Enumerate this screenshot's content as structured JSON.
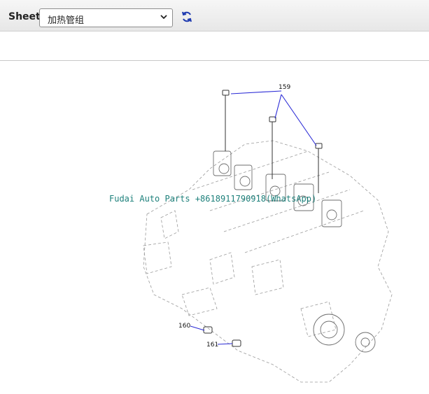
{
  "toolbar": {
    "sheet_label": "Sheet",
    "sheet_value": "加热管组",
    "icons": {
      "dropdown": "chevron-down-icon",
      "refresh": "refresh-icon"
    }
  },
  "diagram": {
    "callouts": [
      "159",
      "160",
      "161"
    ],
    "watermark": "Fudai Auto Parts +8618911790918(WhatsApp)",
    "colors": {
      "leader_lines": "#2b2bd6",
      "watermark": "#117a74",
      "outline": "#9a9a9a"
    }
  }
}
